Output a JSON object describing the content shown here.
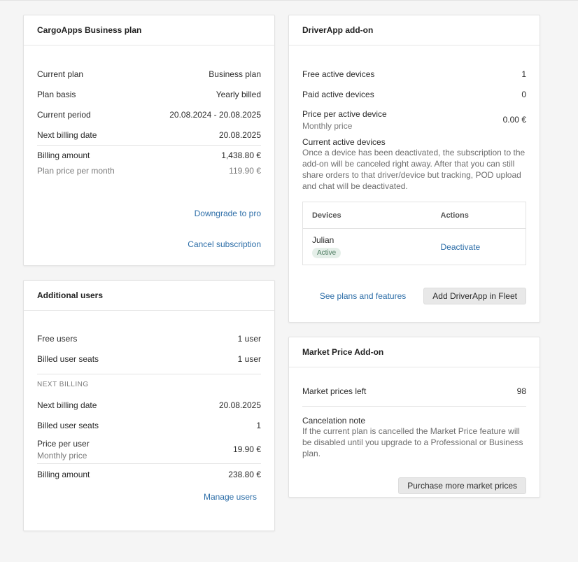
{
  "business_plan": {
    "title": "CargoApps Business plan",
    "rows": [
      {
        "label": "Current plan",
        "value": "Business plan"
      },
      {
        "label": "Plan basis",
        "value": "Yearly billed"
      },
      {
        "label": "Current period",
        "value": "20.08.2024 - 20.08.2025"
      },
      {
        "label": "Next billing date",
        "value": "20.08.2025"
      }
    ],
    "billing_amount_label": "Billing amount",
    "billing_amount_value": "1,438.80 €",
    "plan_price_label": "Plan price per month",
    "plan_price_value": "119.90 €",
    "downgrade_link": "Downgrade to pro",
    "cancel_link": "Cancel subscription"
  },
  "additional_users": {
    "title": "Additional users",
    "free_users_label": "Free users",
    "free_users_value": "1 user",
    "billed_seats_label": "Billed user seats",
    "billed_seats_value": "1 user",
    "next_billing_caption": "NEXT BILLING",
    "next_billing_date_label": "Next billing date",
    "next_billing_date_value": "20.08.2025",
    "next_billed_seats_label": "Billed user seats",
    "next_billed_seats_value": "1",
    "price_per_user_label": "Price per user",
    "price_per_user_sub": "Monthly price",
    "price_per_user_value": "19.90 €",
    "billing_amount_label": "Billing amount",
    "billing_amount_value": "238.80 €",
    "manage_users_link": "Manage users"
  },
  "driverapp": {
    "title": "DriverApp add-on",
    "free_devices_label": "Free active devices",
    "free_devices_value": "1",
    "paid_devices_label": "Paid active devices",
    "paid_devices_value": "0",
    "price_label": "Price per active device",
    "price_sub": "Monthly price",
    "price_value": "0.00 €",
    "current_title": "Current active devices",
    "current_note": "Once a device has been deactivated, the subscription to the add-on will be canceled right away. After that you can still share orders to that driver/device but tracking, POD upload and chat will be deactivated.",
    "table": {
      "col_devices": "Devices",
      "col_actions": "Actions",
      "rows": [
        {
          "name": "Julian",
          "status": "Active",
          "action": "Deactivate"
        }
      ]
    },
    "plans_link": "See plans and features",
    "add_button": "Add DriverApp in Fleet"
  },
  "market_price": {
    "title": "Market Price Add-on",
    "prices_left_label": "Market prices left",
    "prices_left_value": "98",
    "cancel_note_title": "Cancelation note",
    "cancel_note_text": "If the current plan is cancelled the Market Price feature will be disabled until you upgrade to a Professional or Business plan.",
    "purchase_button": "Purchase more market prices"
  }
}
